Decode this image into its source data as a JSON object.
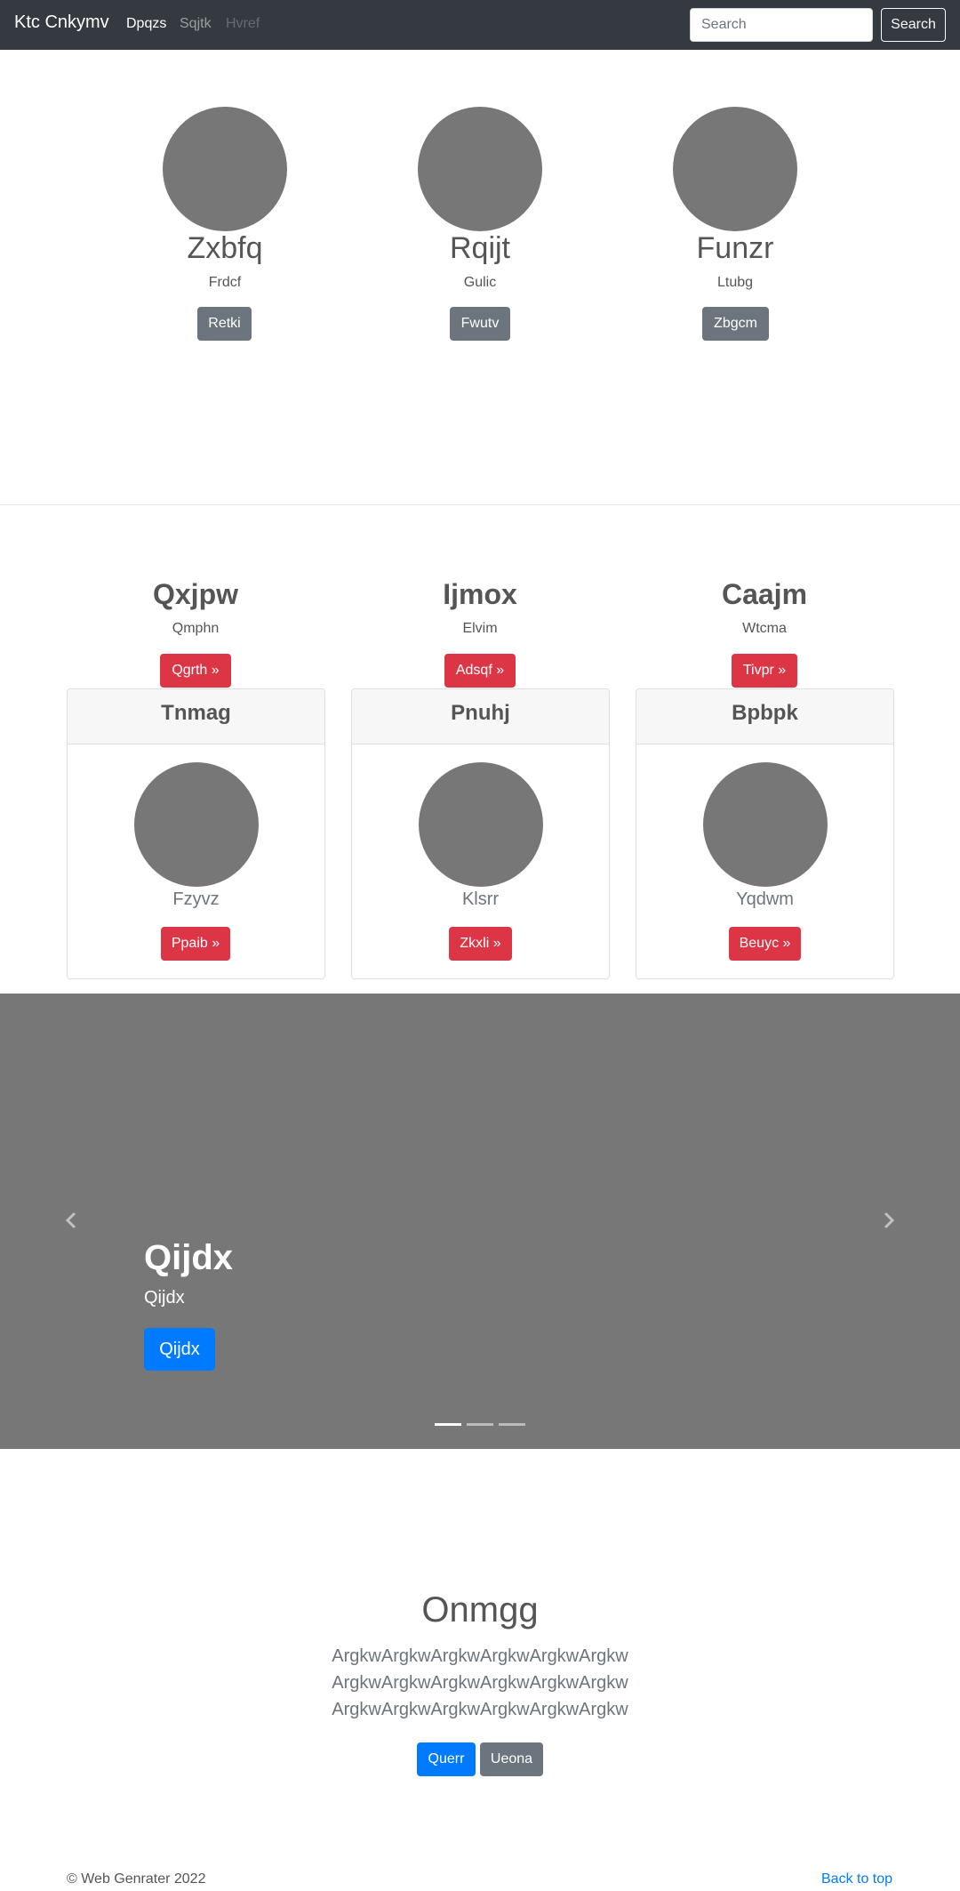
{
  "navbar": {
    "brand": "Ktc Cnkymv",
    "links": [
      "Dpqzs",
      "Sqjtk",
      "Hvref"
    ],
    "search_placeholder": "Search",
    "search_button": "Search",
    "bg_color": "#343a40"
  },
  "team": [
    {
      "name": "Zxbfq",
      "role": "Frdcf",
      "button": "Retki"
    },
    {
      "name": "Rqijt",
      "role": "Gulic",
      "button": "Fwutv"
    },
    {
      "name": "Funzr",
      "role": "Ltubg",
      "button": "Zbgcm"
    }
  ],
  "features": [
    {
      "title": "Qxjpw",
      "text": "Qmphn",
      "button": "Qgrth »"
    },
    {
      "title": "Ijmox",
      "text": "Elvim",
      "button": "Adsqf »"
    },
    {
      "title": "Caajm",
      "text": "Wtcma",
      "button": "Tivpr »"
    }
  ],
  "cards": [
    {
      "header": "Tnmag",
      "text": "Fzyvz",
      "button": "Ppaib »"
    },
    {
      "header": "Pnuhj",
      "text": "Klsrr",
      "button": "Zkxli »"
    },
    {
      "header": "Bpbpk",
      "text": "Yqdwm",
      "button": "Beuyc »"
    }
  ],
  "carousel": {
    "title": "Qijdx",
    "subtitle": "Qijdx",
    "button": "Qijdx",
    "prev_icon": "chevron-left-icon",
    "next_icon": "chevron-right-icon",
    "active_slide": 1,
    "slide_count": 3
  },
  "hero": {
    "title": "Onmgg",
    "lines": [
      "ArgkwArgkwArgkwArgkwArgkwArgkw",
      "ArgkwArgkwArgkwArgkwArgkwArgkw",
      "ArgkwArgkwArgkwArgkwArgkwArgkw"
    ],
    "primary_button": "Querr",
    "secondary_button": "Ueona"
  },
  "footer": {
    "copyright": "© Web Genrater 2022",
    "back_to_top": "Back to top"
  },
  "colors": {
    "primary": "#007bff",
    "danger": "#dc3545",
    "secondary": "#6c757d",
    "placeholder": "#777777"
  }
}
